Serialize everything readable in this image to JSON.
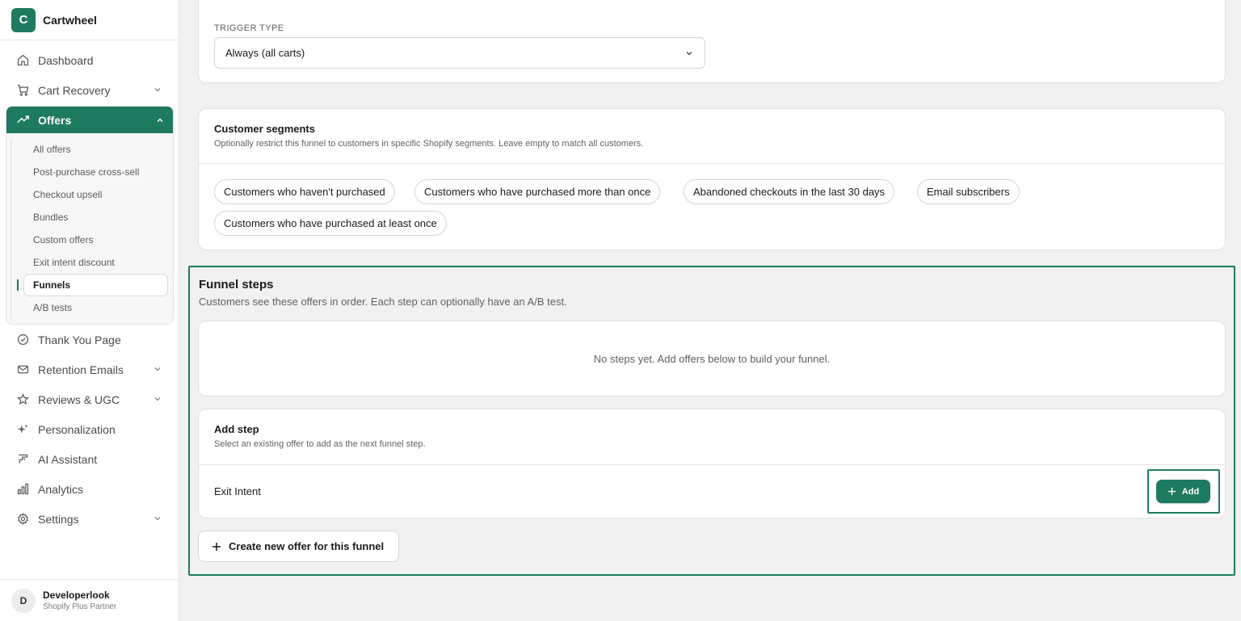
{
  "brand": {
    "initial": "C",
    "name": "Cartwheel"
  },
  "nav": {
    "dashboard": "Dashboard",
    "cart_recovery": "Cart Recovery",
    "offers": "Offers",
    "offers_sub": [
      "All offers",
      "Post-purchase cross-sell",
      "Checkout upsell",
      "Bundles",
      "Custom offers",
      "Exit intent discount",
      "Funnels",
      "A/B tests"
    ],
    "thank_you": "Thank You Page",
    "retention": "Retention Emails",
    "reviews": "Reviews & UGC",
    "personalization": "Personalization",
    "ai_assistant": "AI Assistant",
    "analytics": "Analytics",
    "settings": "Settings"
  },
  "user": {
    "initial": "D",
    "name": "Developerlook",
    "role": "Shopify Plus Partner"
  },
  "trigger": {
    "label": "TRIGGER TYPE",
    "value": "Always (all carts)"
  },
  "segments": {
    "title": "Customer segments",
    "subtitle": "Optionally restrict this funnel to customers in specific Shopify segments. Leave empty to match all customers.",
    "chips": [
      "Customers who haven't purchased",
      "Customers who have purchased more than once",
      "Abandoned checkouts in the last 30 days",
      "Email subscribers",
      "Customers who have purchased at least once"
    ]
  },
  "funnel": {
    "title": "Funnel steps",
    "subtitle": "Customers see these offers in order. Each step can optionally have an A/B test.",
    "empty": "No steps yet. Add offers below to build your funnel."
  },
  "add_step": {
    "title": "Add step",
    "subtitle": "Select an existing offer to add as the next funnel step.",
    "offer": "Exit Intent",
    "button": "Add"
  },
  "create_button": "Create new offer for this funnel",
  "colors": {
    "accent": "#1f7a62"
  }
}
